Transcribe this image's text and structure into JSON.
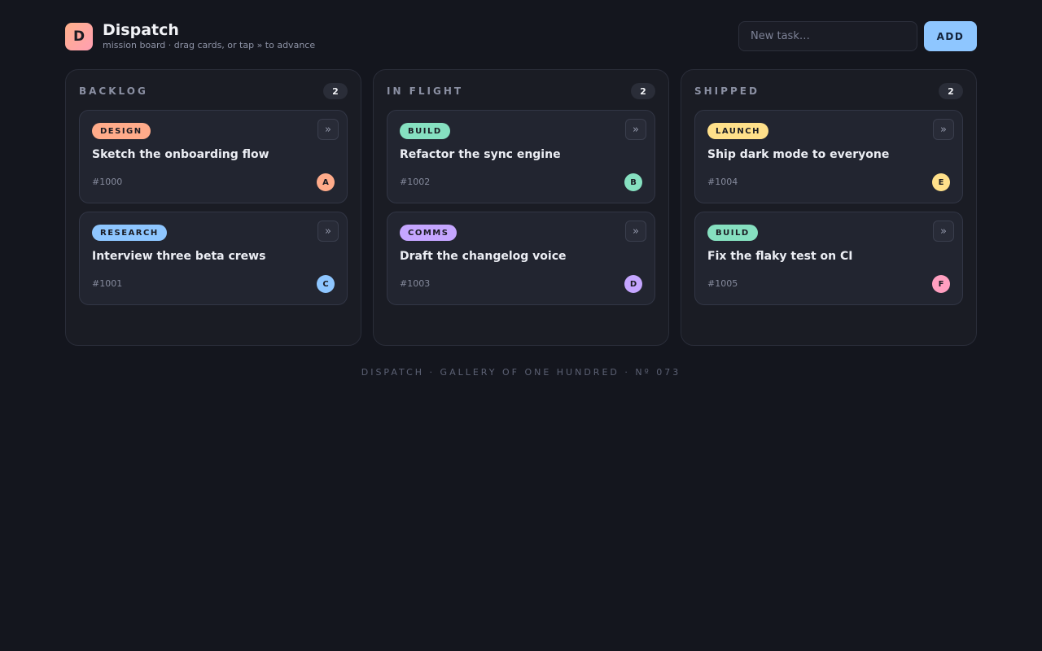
{
  "header": {
    "logo_letter": "D",
    "title": "Dispatch",
    "subtitle": "mission board · drag cards, or tap » to advance",
    "input_placeholder": "New task…",
    "add_label": "ADD"
  },
  "colors": {
    "background": "#14161e",
    "accent": "#8ec6ff"
  },
  "columns": [
    {
      "title": "BACKLOG",
      "count": "2",
      "cards": [
        {
          "tag": "DESIGN",
          "tag_color": "#ffab8a",
          "title": "Sketch the onboarding flow",
          "id": "#1000",
          "avatar": "A",
          "avatar_color": "#ffab8a",
          "advance": "»"
        },
        {
          "tag": "RESEARCH",
          "tag_color": "#8ec6ff",
          "title": "Interview three beta crews",
          "id": "#1001",
          "avatar": "C",
          "avatar_color": "#8ec6ff",
          "advance": "»"
        }
      ]
    },
    {
      "title": "IN FLIGHT",
      "count": "2",
      "cards": [
        {
          "tag": "BUILD",
          "tag_color": "#86e0c0",
          "title": "Refactor the sync engine",
          "id": "#1002",
          "avatar": "B",
          "avatar_color": "#86e0c0",
          "advance": "»"
        },
        {
          "tag": "COMMS",
          "tag_color": "#c5a6ff",
          "title": "Draft the changelog voice",
          "id": "#1003",
          "avatar": "D",
          "avatar_color": "#c5a6ff",
          "advance": "»"
        }
      ]
    },
    {
      "title": "SHIPPED",
      "count": "2",
      "cards": [
        {
          "tag": "LAUNCH",
          "tag_color": "#ffe08a",
          "title": "Ship dark mode to everyone",
          "id": "#1004",
          "avatar": "E",
          "avatar_color": "#ffe08a",
          "advance": "»"
        },
        {
          "tag": "BUILD",
          "tag_color": "#86e0c0",
          "title": "Fix the flaky test on CI",
          "id": "#1005",
          "avatar": "F",
          "avatar_color": "#ff9fc0",
          "advance": "»"
        }
      ]
    }
  ],
  "footer": "DISPATCH · GALLERY OF ONE HUNDRED · Nº 073"
}
